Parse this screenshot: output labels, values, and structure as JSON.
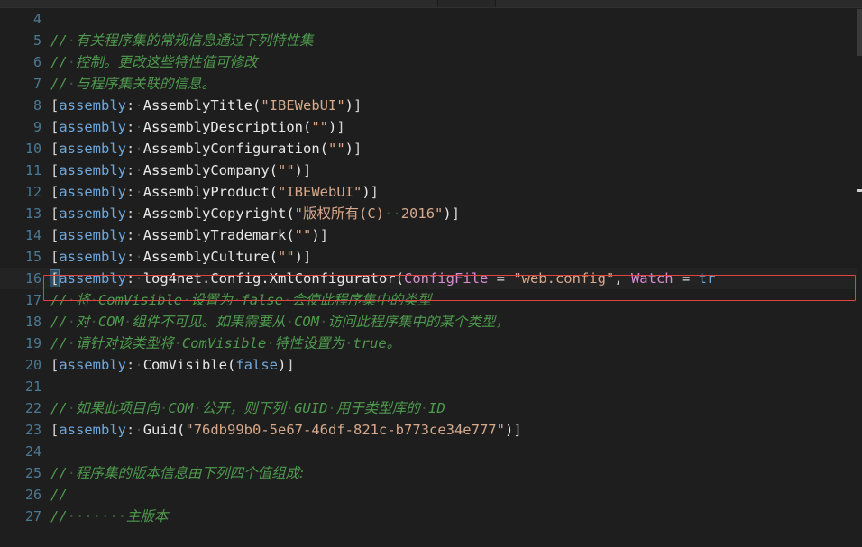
{
  "window": {
    "app": "code-editor",
    "theme_background": "#1e1e1e",
    "line_number_color": "#4a7a96",
    "comment_color": "#4e9a4e",
    "string_color": "#d7a98c",
    "keyword_color": "#6fa8dc",
    "parameter_color": "#d98cd4",
    "annotation_box_color": "#e0443e",
    "active_line_background": "#232323"
  },
  "annotation": {
    "name": "red-highlight-rectangle",
    "target_line": "16",
    "color": "#e0443e"
  },
  "ruler": {
    "mark_color": "#cfcfcf",
    "scroll_thumb_color": "#3a3a3a"
  },
  "editor": {
    "language": "csharp",
    "first_visible_line": 4,
    "last_visible_line": 27,
    "lines": [
      {
        "n": "4",
        "text": ""
      },
      {
        "n": "5",
        "text": "// 有关程序集的常规信息通过下列特性集"
      },
      {
        "n": "6",
        "text": "// 控制。更改这些特性值可修改"
      },
      {
        "n": "7",
        "text": "// 与程序集关联的信息。"
      },
      {
        "n": "8",
        "text": "[assembly: AssemblyTitle(\"IBEWebUI\")]"
      },
      {
        "n": "9",
        "text": "[assembly: AssemblyDescription(\"\")]"
      },
      {
        "n": "10",
        "text": "[assembly: AssemblyConfiguration(\"\")]"
      },
      {
        "n": "11",
        "text": "[assembly: AssemblyCompany(\"\")]"
      },
      {
        "n": "12",
        "text": "[assembly: AssemblyProduct(\"IBEWebUI\")]"
      },
      {
        "n": "13",
        "text": "[assembly: AssemblyCopyright(\"版权所有(C)  2016\")]"
      },
      {
        "n": "14",
        "text": "[assembly: AssemblyTrademark(\"\")]"
      },
      {
        "n": "15",
        "text": "[assembly: AssemblyCulture(\"\")]"
      },
      {
        "n": "16",
        "text": "[assembly: log4net.Config.XmlConfigurator(ConfigFile = \"web.config\", Watch = tr"
      },
      {
        "n": "17",
        "text": "// 将 ComVisible 设置为 false 会使此程序集中的类型"
      },
      {
        "n": "18",
        "text": "// 对 COM 组件不可见。如果需要从 COM 访问此程序集中的某个类型，"
      },
      {
        "n": "19",
        "text": "// 请针对该类型将 ComVisible 特性设置为 true。"
      },
      {
        "n": "20",
        "text": "[assembly: ComVisible(false)]"
      },
      {
        "n": "21",
        "text": ""
      },
      {
        "n": "22",
        "text": "// 如果此项目向 COM 公开，则下列 GUID 用于类型库的 ID"
      },
      {
        "n": "23",
        "text": "[assembly: Guid(\"76db99b0-5e67-46df-821c-b773ce34e777\")]"
      },
      {
        "n": "24",
        "text": ""
      },
      {
        "n": "25",
        "text": "// 程序集的版本信息由下列四个值组成:"
      },
      {
        "n": "26",
        "text": "//"
      },
      {
        "n": "27",
        "text": "//      主版本"
      }
    ],
    "tokens": {
      "assembly_keyword": "assembly",
      "guid_value": "76db99b0-5e67-46df-821c-b773ce34e777",
      "title_value": "IBEWebUI",
      "product_value": "IBEWebUI",
      "copyright_value": "版权所有(C)  2016",
      "config_file_param": "ConfigFile",
      "config_file_value": "web.config",
      "watch_param": "Watch",
      "watch_value_truncated": "tr",
      "log4net_type": "log4net.Config.XmlConfigurator",
      "com_visible_value": "false"
    }
  }
}
